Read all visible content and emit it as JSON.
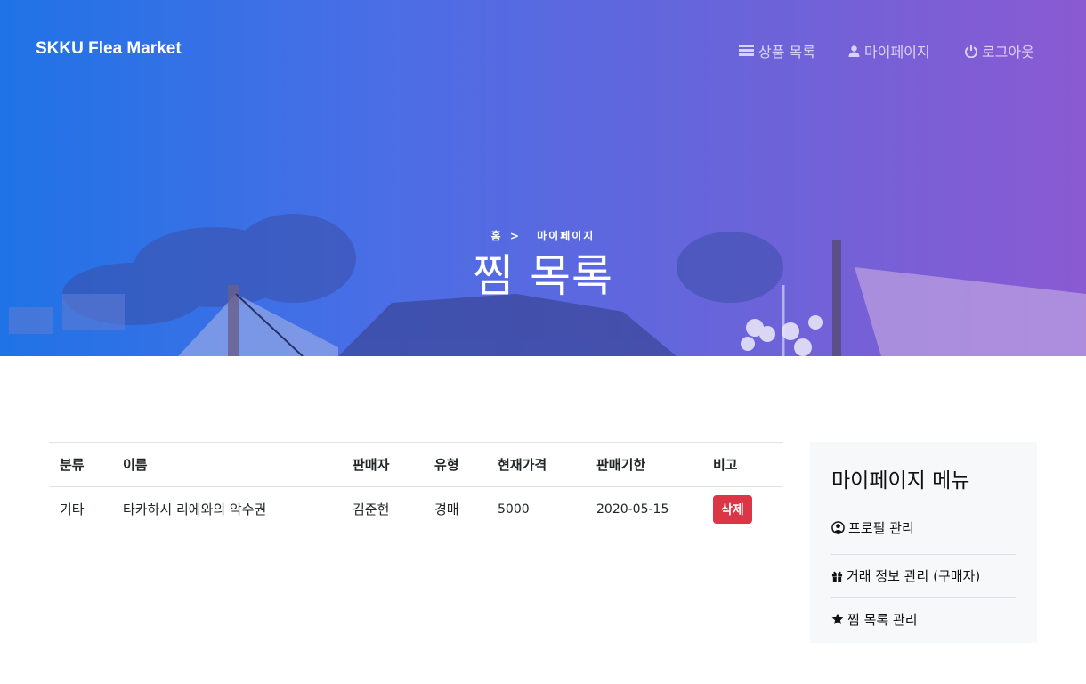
{
  "navbar": {
    "brand": "SKKU Flea Market",
    "items": [
      {
        "label": "상품 목록",
        "icon": "list-icon"
      },
      {
        "label": "마이페이지",
        "icon": "user-icon"
      },
      {
        "label": "로그아웃",
        "icon": "power-icon"
      }
    ]
  },
  "hero": {
    "breadcrumb": {
      "home": "홈",
      "separator": ">",
      "current": "마이페이지"
    },
    "title": "찜 목록"
  },
  "table": {
    "headers": [
      "분류",
      "이름",
      "판매자",
      "유형",
      "현재가격",
      "판매기한",
      "비고"
    ],
    "rows": [
      {
        "category": "기타",
        "name": "타카하시 리에와의 악수권",
        "seller": "김준현",
        "type": "경매",
        "price": "5000",
        "deadline": "2020-05-15",
        "action": "삭제"
      }
    ]
  },
  "sidebar": {
    "title": "마이페이지 메뉴",
    "items": [
      {
        "label": "프로필 관리",
        "icon": "user-circle-icon"
      },
      {
        "label": "거래 정보 관리 (구매자)",
        "icon": "gift-icon"
      },
      {
        "label": "찜 목록 관리",
        "icon": "star-icon"
      }
    ]
  },
  "colors": {
    "hero_gradient_start": "#1f73e6",
    "hero_gradient_end": "#8a5ad2",
    "delete_button": "#dc3545",
    "sidebar_bg": "#f7f8fa"
  }
}
